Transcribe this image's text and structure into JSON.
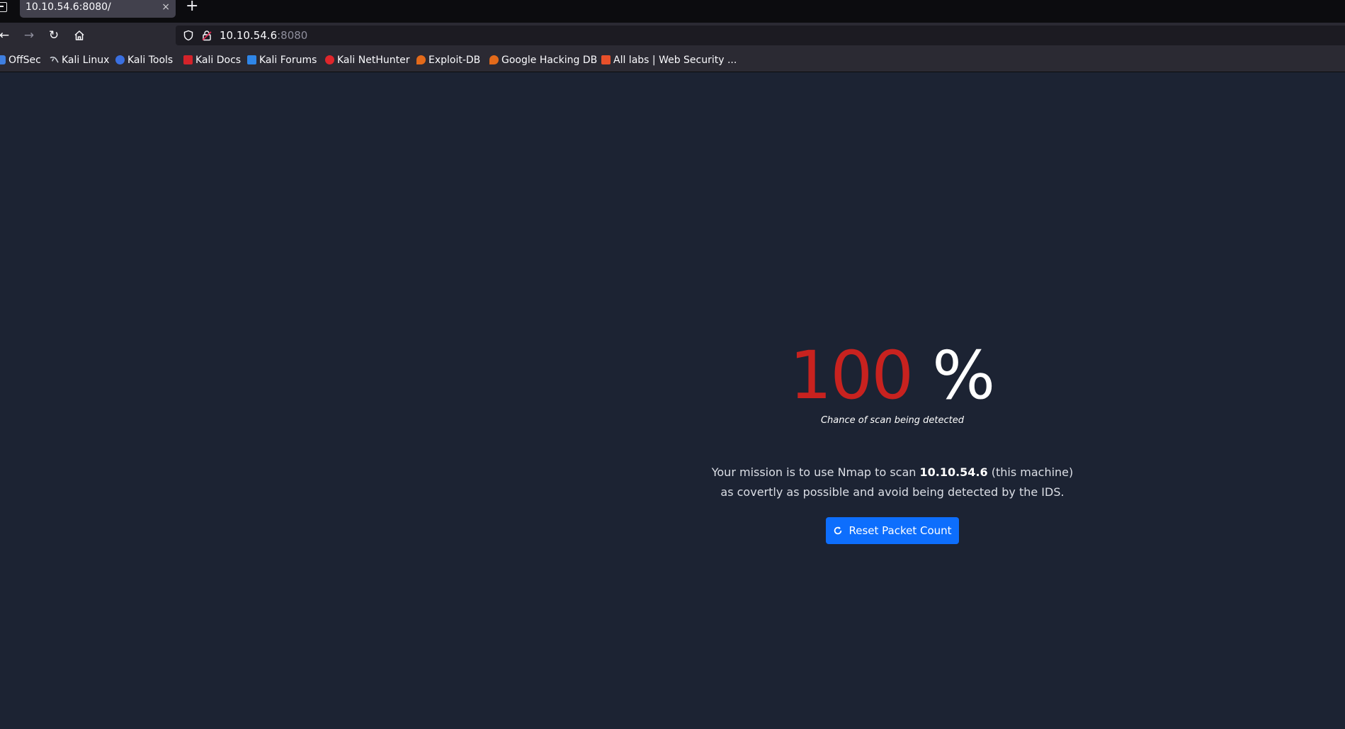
{
  "browser": {
    "tab": {
      "title": "10.10.54.6:8080/",
      "close_glyph": "×"
    },
    "new_tab_glyph": "+",
    "nav": {
      "back_glyph": "←",
      "forward_glyph": "→",
      "reload_glyph": "↻",
      "home_icon": "home-icon"
    },
    "url": {
      "host": "10.10.54.6",
      "port": ":8080"
    },
    "bookmarks": [
      {
        "label": "OffSec",
        "icon": "offsec-icon",
        "color": "#3f7fe0"
      },
      {
        "label": "Kali Linux",
        "icon": "kali-linux-icon",
        "color": "#cfd3da"
      },
      {
        "label": "Kali Tools",
        "icon": "kali-tools-icon",
        "color": "#3a6fe0"
      },
      {
        "label": "Kali Docs",
        "icon": "kali-docs-icon",
        "color": "#d4232a"
      },
      {
        "label": "Kali Forums",
        "icon": "kali-forums-icon",
        "color": "#2f86e8"
      },
      {
        "label": "Kali NetHunter",
        "icon": "kali-nethunter-icon",
        "color": "#e0262b"
      },
      {
        "label": "Exploit-DB",
        "icon": "exploit-db-icon",
        "color": "#e36a1a"
      },
      {
        "label": "Google Hacking DB",
        "icon": "ghdb-icon",
        "color": "#e36a1a"
      },
      {
        "label": "All labs | Web Security ...",
        "icon": "portswigger-icon",
        "color": "#e8502a"
      }
    ]
  },
  "page": {
    "detection_value": "100",
    "detection_unit": "%",
    "caption": "Chance of scan being detected",
    "mission_prefix": "Your mission is to use Nmap to scan ",
    "mission_target": "10.10.54.6",
    "mission_suffix": " (this machine)",
    "mission_line2": "as covertly as possible and avoid being detected by the IDS.",
    "reset_button_label": "Reset Packet Count",
    "colors": {
      "background": "#1c2333",
      "percent_value": "#c8221f",
      "button": "#0d6efd"
    }
  }
}
